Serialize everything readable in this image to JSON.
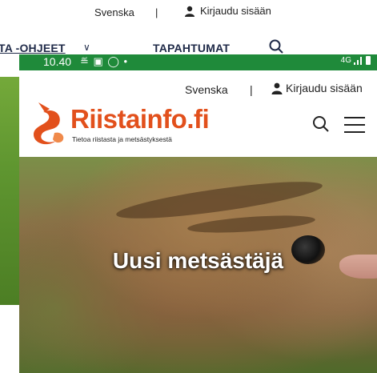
{
  "background_page": {
    "topbar": {
      "language": "Svenska",
      "separator": "|",
      "login": "Kirjaudu sisään"
    },
    "nav": {
      "item1": "TA -OHJEET",
      "item2": "TAPAHTUMAT"
    }
  },
  "phone": {
    "statusbar": {
      "time": "10.40",
      "icons": "≝ ▣ ◯ •",
      "network": "4G"
    },
    "topbar": {
      "language": "Svenska",
      "separator": "|",
      "login": "Kirjaudu sisään"
    },
    "logo": {
      "name": "Riistainfo.fi",
      "tagline": "Tietoa riistasta ja metsästyksestä"
    },
    "hero": {
      "title": "Uusi metsästäjä"
    }
  },
  "colors": {
    "brand_orange": "#e2501c",
    "status_green": "#1f8a3a",
    "nav_navy": "#1f2a48"
  },
  "icons": [
    "user-icon",
    "search-icon",
    "menu-icon",
    "chevron-down-icon",
    "battery-icon",
    "signal-icon"
  ]
}
